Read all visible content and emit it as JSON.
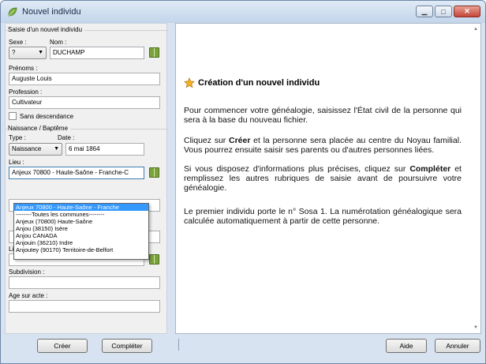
{
  "window": {
    "title": "Nouvel individu"
  },
  "form": {
    "legend_saisie": "Saisie d'un nouvel individu",
    "sexe_label": "Sexe :",
    "sexe_value": "?",
    "nom_label": "Nom :",
    "nom_value": "DUCHAMP",
    "prenoms_label": "Prénoms :",
    "prenoms_value": "Auguste Louis",
    "profession_label": "Profession :",
    "profession_value": "Cultivateur",
    "sans_descendance_label": "Sans descendance",
    "legend_naissance": "Naissance / Baptême",
    "type_label": "Type :",
    "type_value": "Naissance",
    "date_label": "Date :",
    "date_value": "6 mai 1864",
    "lieu_label": "Lieu :",
    "lieu_value": "Anjeux 70800 - Haute-Saône - Franche-C",
    "lieu2_label": "Lieu :",
    "lieu2_value": "",
    "subdivision_label": "Subdivision :",
    "subdivision_value": "",
    "age_label": "Age sur acte :",
    "age_value": ""
  },
  "dropdown": {
    "items": [
      "Anjeux 70800 - Haute-Saône - Franche",
      "--------Toutes les communes--------",
      "Anjeux (70800) Haute-Saône",
      "Anjou (38150) Isère",
      "Anjou  CANADA",
      "Anjouin (36210) Indre",
      "Anjoutey (90170) Territoire-de-Belfort"
    ]
  },
  "help": {
    "title": "Création d'un nouvel individu",
    "p1": "Pour commencer votre généalogie, saisissez l'État civil de la personne qui sera à la base du nouveau fichier.",
    "p2_a": "Cliquez sur ",
    "p2_b": "Créer",
    "p2_c": " et la personne sera placée au centre du Noyau familial. Vous pourrez ensuite saisir ses parents ou d'autres personnes liées.",
    "p3_a": "Si vous disposez d'informations plus précises, cliquez sur ",
    "p3_b": "Compléter",
    "p3_c": " et remplissez les autres rubriques de saisie avant de poursuivre votre généalogie.",
    "p4": "Le premier individu porte le n° Sosa 1. La numérotation généalogique sera calculée automatiquement à partir de cette personne."
  },
  "buttons": {
    "creer": "Créer",
    "completer": "Compléter",
    "aide": "Aide",
    "annuler": "Annuler"
  },
  "colors": {
    "accent_selection": "#3399ff",
    "book_green": "#78a33a"
  }
}
